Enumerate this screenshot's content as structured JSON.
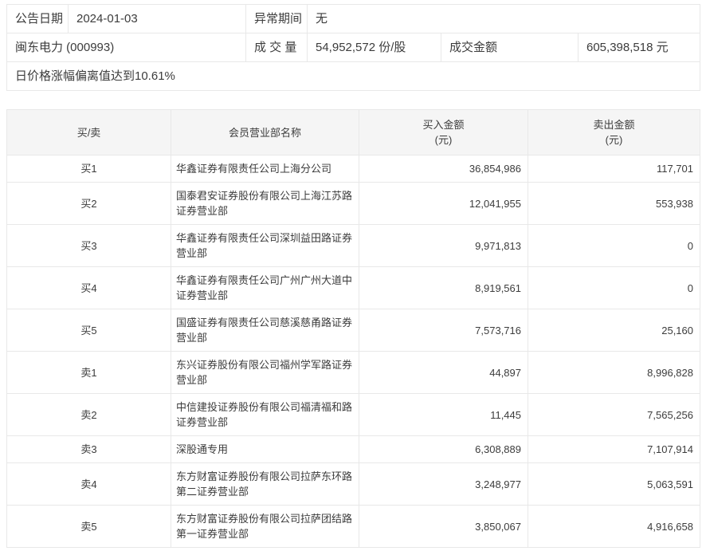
{
  "summary": {
    "announce_label": "公告日期",
    "announce_date": "2024-01-03",
    "abnormal_label": "异常期间",
    "abnormal_value": "无",
    "stock_name": "闽东电力 (000993)",
    "volume_label": "成 交 量",
    "volume_value": "54,952,572 份/股",
    "turnover_label": "成交金额",
    "turnover_value": "605,398,518 元",
    "deviation_note": "日价格涨幅偏离值达到10.61%"
  },
  "table": {
    "headers": {
      "side": "买/卖",
      "broker": "会员营业部名称",
      "buy": "买入金额",
      "buy_unit": "(元)",
      "sell": "卖出金额",
      "sell_unit": "(元)"
    },
    "rows": [
      {
        "side": "买1",
        "broker": "华鑫证券有限责任公司上海分公司",
        "buy": "36,854,986",
        "sell": "117,701"
      },
      {
        "side": "买2",
        "broker": "国泰君安证券股份有限公司上海江苏路证券营业部",
        "buy": "12,041,955",
        "sell": "553,938"
      },
      {
        "side": "买3",
        "broker": "华鑫证券有限责任公司深圳益田路证券营业部",
        "buy": "9,971,813",
        "sell": "0"
      },
      {
        "side": "买4",
        "broker": "华鑫证券有限责任公司广州广州大道中证券营业部",
        "buy": "8,919,561",
        "sell": "0"
      },
      {
        "side": "买5",
        "broker": "国盛证券有限责任公司慈溪慈甬路证券营业部",
        "buy": "7,573,716",
        "sell": "25,160"
      },
      {
        "side": "卖1",
        "broker": "东兴证券股份有限公司福州学军路证券营业部",
        "buy": "44,897",
        "sell": "8,996,828"
      },
      {
        "side": "卖2",
        "broker": "中信建投证券股份有限公司福清福和路证券营业部",
        "buy": "11,445",
        "sell": "7,565,256"
      },
      {
        "side": "卖3",
        "broker": "深股通专用",
        "buy": "6,308,889",
        "sell": "7,107,914"
      },
      {
        "side": "卖4",
        "broker": "东方财富证券股份有限公司拉萨东环路第二证券营业部",
        "buy": "3,248,977",
        "sell": "5,063,591"
      },
      {
        "side": "卖5",
        "broker": "东方财富证券股份有限公司拉萨团结路第一证券营业部",
        "buy": "3,850,067",
        "sell": "4,916,658"
      }
    ]
  },
  "colors": {
    "border": "#e8e8e8",
    "header_bg": "#f5f5f5",
    "text": "#3c3c3c"
  }
}
